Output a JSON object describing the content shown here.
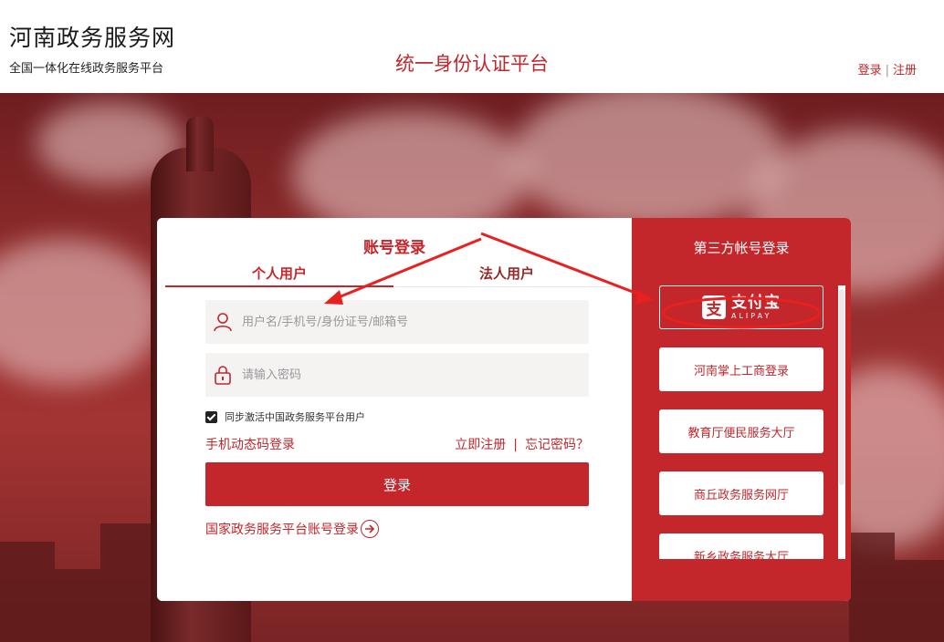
{
  "header": {
    "site_title": "河南政务服务网",
    "site_subtitle": "全国一体化在线政务服务平台",
    "platform_title": "统一身份认证平台",
    "login_link": "登录",
    "link_separator": "|",
    "register_link": "注册"
  },
  "login": {
    "title": "账号登录",
    "tabs": [
      {
        "label": "个人用户",
        "active": true
      },
      {
        "label": "法人用户",
        "active": false
      }
    ],
    "username_placeholder": "用户名/手机号/身份证号/邮箱号",
    "password_placeholder": "请输入密码",
    "sync_checkbox_label": "同步激活中国政务服务平台用户",
    "sync_checked": true,
    "sms_login": "手机动态码登录",
    "register_now": "立即注册",
    "link_separator": "|",
    "forgot_password": "忘记密码？",
    "login_button": "登录",
    "national_login": "国家政务服务平台账号登录"
  },
  "third_party": {
    "title": "第三方帐号登录",
    "alipay": {
      "logo_char": "支",
      "name_cn": "支付宝",
      "name_en": "ALIPAY"
    },
    "items": [
      {
        "label": "河南掌上工商登录"
      },
      {
        "label": "教育厅便民服务大厅"
      },
      {
        "label": "商丘政务服务网厅"
      },
      {
        "label": "新乡政务服务大厅"
      }
    ]
  },
  "colors": {
    "brand_red": "#c3262b",
    "annotation_red": "#e8201f"
  },
  "icons": [
    "user-icon",
    "lock-icon",
    "checkbox-checked-icon",
    "arrow-right-circle-icon",
    "alipay-logo-icon"
  ]
}
